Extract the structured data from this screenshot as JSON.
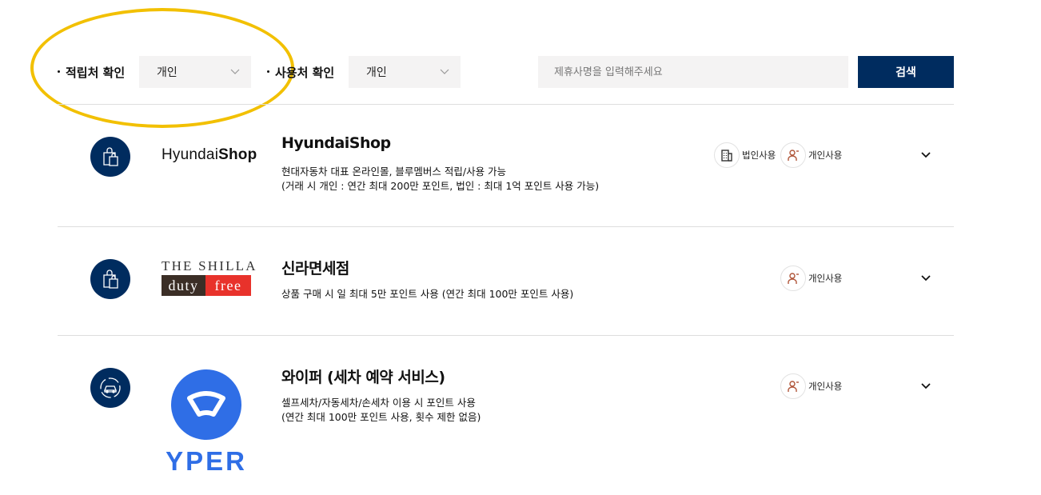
{
  "filters": {
    "earn_label": "적립처 확인",
    "earn_value": "개인",
    "use_label": "사용처 확인",
    "use_value": "개인",
    "search_placeholder": "제휴사명을 입력해주세요",
    "search_button": "검색"
  },
  "partners": [
    {
      "category_icon": "shopping-bag-icon",
      "logo_text_a": "Hyundai",
      "logo_text_b": "Shop",
      "name": "HyundaiShop",
      "desc_1": "현대자동차 대표 온라인몰, 블루멤버스 적립/사용 가능",
      "desc_2": "(거래 시 개인 : 연간 최대 200만 포인트, 법인 : 최대 1억 포인트 사용 가능)",
      "usage_corporate": "법인사용",
      "usage_personal": "개인사용"
    },
    {
      "category_icon": "shopping-bag-icon",
      "logo_text_top": "THE SHILLA",
      "logo_text_duty": "duty",
      "logo_text_free": "free",
      "name": "신라면세점",
      "desc_1": "상품 구매 시 일 최대 5만 포인트 사용 (연간 최대 100만 포인트 사용)",
      "usage_personal": "개인사용"
    },
    {
      "category_icon": "car-wash-icon",
      "logo_text": "YPER",
      "name": "와이퍼 (세차 예약 서비스)",
      "desc_1": "셀프세차/자동세차/손세차 이용 시 포인트 사용",
      "desc_2": "(연간 최대 100만 포인트 사용, 횟수 제한 없음)",
      "usage_personal": "개인사용"
    }
  ],
  "colors": {
    "navy": "#002c5f",
    "highlight": "#f2c000",
    "wyper_blue": "#2f6ee6",
    "shilla_brown": "#3b2e26",
    "shilla_red": "#e8322b",
    "usage_icon": "#b0563a"
  }
}
